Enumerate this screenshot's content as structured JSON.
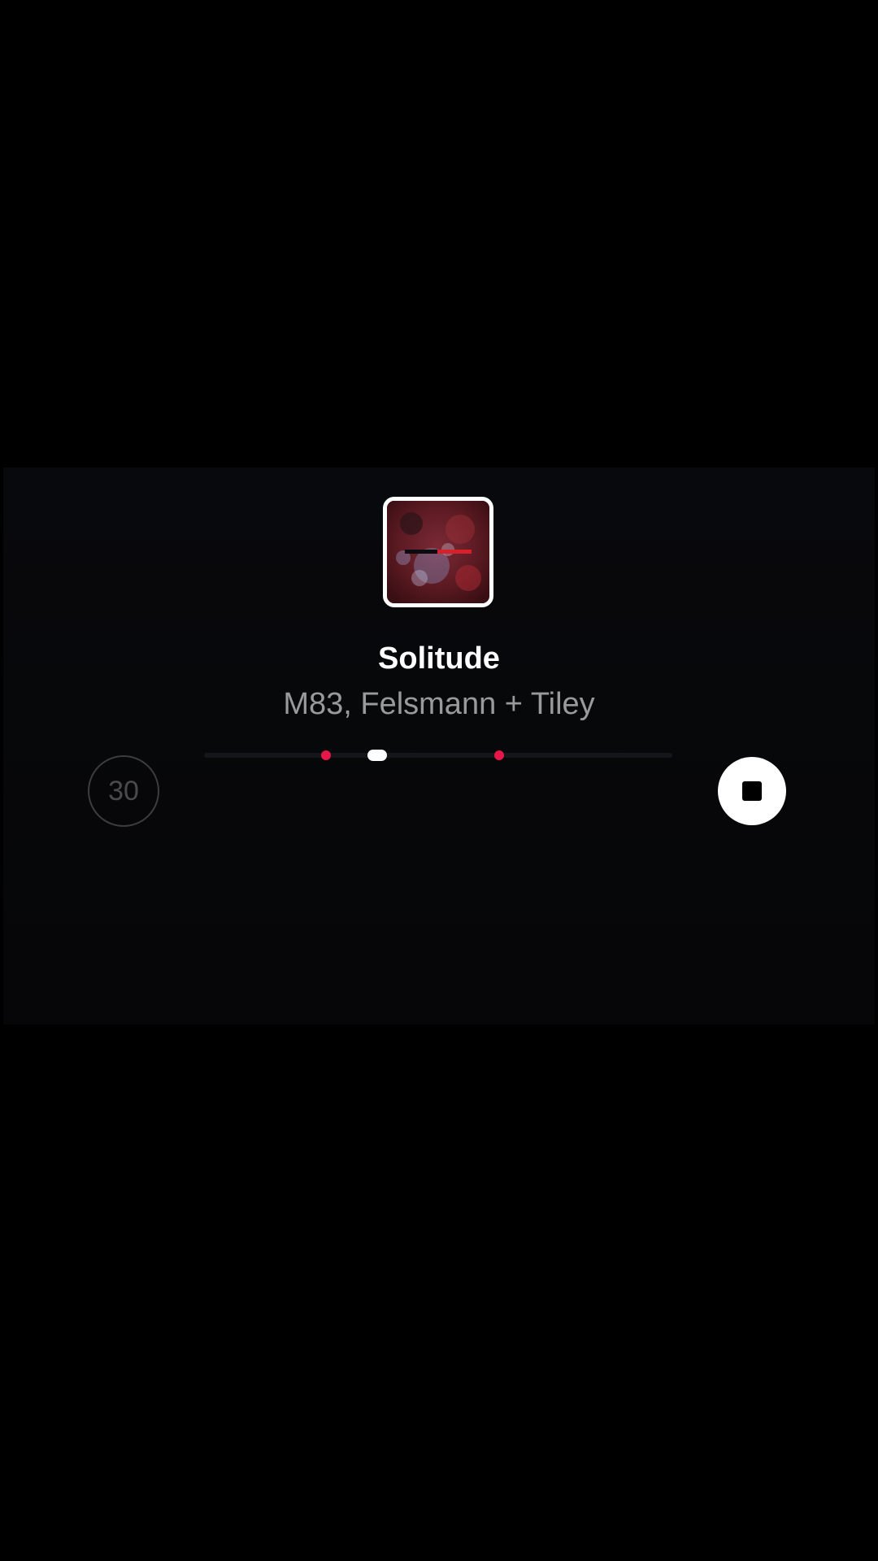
{
  "now_playing": {
    "title": "Solitude",
    "artist": "M83, Felsmann + Tiley",
    "cover_icon": "album-art",
    "progress": 0.37
  },
  "controls": {
    "duration_label": "30",
    "stop_icon": "stop-icon"
  },
  "markers": [
    0.26,
    0.63
  ],
  "colors": {
    "background": "#000000",
    "sheet": "#08090c",
    "accent": "#e8174a",
    "title": "#ffffff",
    "artist": "#9a9a9a"
  }
}
